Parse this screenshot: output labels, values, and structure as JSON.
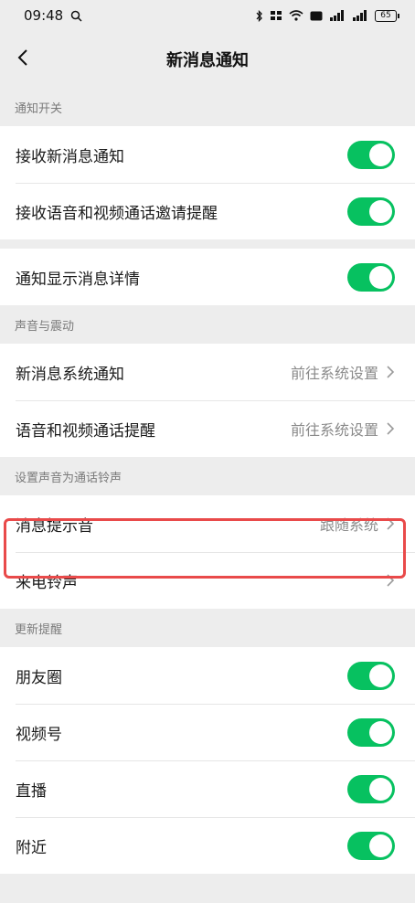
{
  "status_bar": {
    "time": "09:48",
    "battery": "65"
  },
  "nav": {
    "title": "新消息通知"
  },
  "sections": {
    "notify_switch": {
      "header": "通知开关",
      "receive_new": "接收新消息通知",
      "receive_call_invite": "接收语音和视频通话邀请提醒",
      "show_details": "通知显示消息详情"
    },
    "sound_vibration": {
      "header": "声音与震动",
      "new_msg_system": "新消息系统通知",
      "new_msg_system_value": "前往系统设置",
      "call_remind": "语音和视频通话提醒",
      "call_remind_value": "前往系统设置"
    },
    "ringtone": {
      "header": "设置声音为通话铃声",
      "msg_tone": "消息提示音",
      "msg_tone_value": "跟随系统",
      "call_ringtone": "来电铃声"
    },
    "updates": {
      "header": "更新提醒",
      "moments": "朋友圈",
      "channels": "视频号",
      "live": "直播",
      "nearby": "附近"
    }
  },
  "colors": {
    "toggle_on": "#07c160",
    "highlight": "#e94a4a"
  }
}
